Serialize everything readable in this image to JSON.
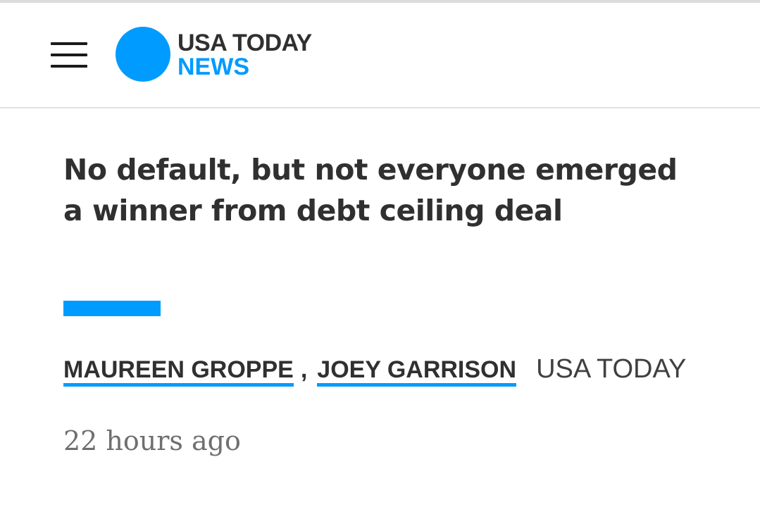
{
  "colors": {
    "brand_blue": "#009bff",
    "text_dark": "#303030",
    "text_muted": "#6f6f6f"
  },
  "header": {
    "menu_icon": "hamburger-menu-icon",
    "logo_line1": "USA TODAY",
    "logo_line2": "NEWS"
  },
  "article": {
    "headline": "No default, but not everyone emerged a winner from debt ceiling deal",
    "authors": [
      "MAUREEN GROPPE",
      "JOEY GARRISON"
    ],
    "author_separator": ",",
    "source": "USA TODAY",
    "timestamp": "22 hours ago"
  }
}
